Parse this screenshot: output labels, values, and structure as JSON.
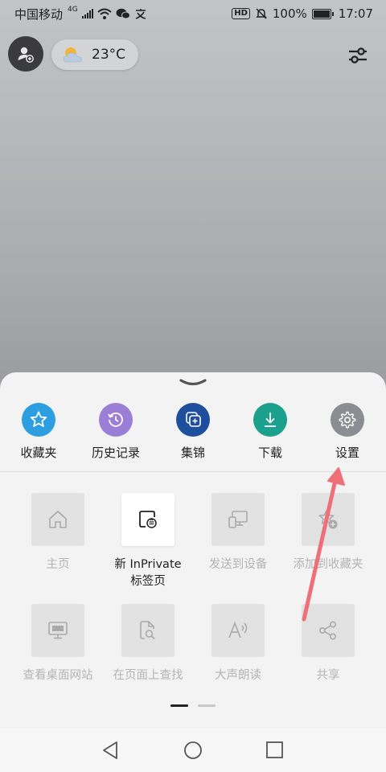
{
  "status_bar": {
    "carrier": "中国移动",
    "network": "4G",
    "battery": "100%",
    "time": "17:07",
    "hd_badge": "HD"
  },
  "top": {
    "weather_temp": "23°C"
  },
  "quick_actions": [
    {
      "label": "收藏夹",
      "color": "#2d9fe0",
      "icon": "star-icon"
    },
    {
      "label": "历史记录",
      "color": "#9b7fd6",
      "icon": "history-icon"
    },
    {
      "label": "集锦",
      "color": "#1e4f9c",
      "icon": "collections-icon"
    },
    {
      "label": "下载",
      "color": "#1aa08c",
      "icon": "download-icon"
    },
    {
      "label": "设置",
      "color": "#8a8d91",
      "icon": "gear-icon"
    }
  ],
  "grid": [
    {
      "label": "主页",
      "icon": "home-icon",
      "active": false
    },
    {
      "label": "新 InPrivate\n标签页",
      "line1": "新 InPrivate",
      "line2": "标签页",
      "icon": "inprivate-tab-icon",
      "active": true
    },
    {
      "label": "发送到设备",
      "icon": "send-to-device-icon",
      "active": false
    },
    {
      "label": "添加到收藏夹",
      "icon": "add-favorite-icon",
      "active": false
    },
    {
      "label": "查看桌面网站",
      "icon": "desktop-site-icon",
      "active": false
    },
    {
      "label": "在页面上查找",
      "icon": "find-on-page-icon",
      "active": false
    },
    {
      "label": "大声朗读",
      "icon": "read-aloud-icon",
      "active": false
    },
    {
      "label": "共享",
      "icon": "share-icon",
      "active": false
    }
  ],
  "pager": {
    "current": 1,
    "total": 2
  },
  "colors": {
    "annotation_arrow": "#ef6f78",
    "sheet_bg": "#f3f3f3"
  }
}
